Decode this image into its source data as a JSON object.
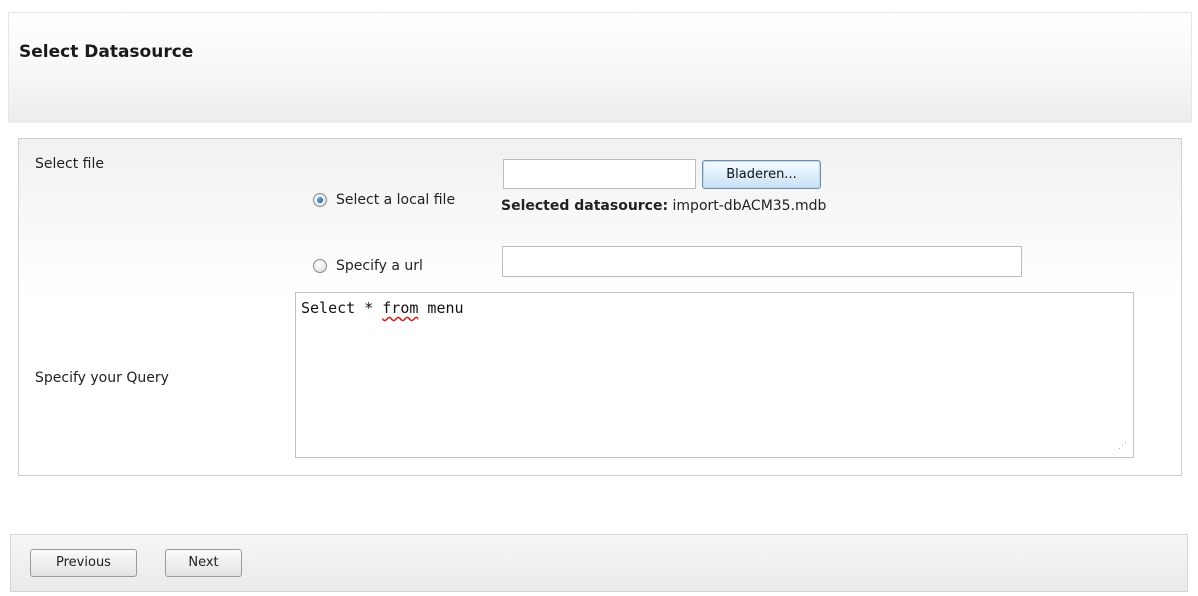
{
  "header": {
    "title": "Select Datasource"
  },
  "form": {
    "select_file_label": "Select file",
    "browse_button": "Bladeren...",
    "file_value": "",
    "local_file_option": {
      "label": "Select a local file",
      "checked": true
    },
    "selected_datasource_label": "Selected datasource:",
    "selected_datasource_value": "import-dbACM35.mdb",
    "url_option": {
      "label": "Specify a url",
      "checked": false
    },
    "url_value": "",
    "query_label": "Specify your Query",
    "query_text": {
      "before": "Select * ",
      "misspelled": "from",
      "after": " menu"
    }
  },
  "footer": {
    "previous_button": "Previous",
    "next_button": "Next"
  },
  "icons": {
    "resize_grip": "resize-grip-icon"
  }
}
